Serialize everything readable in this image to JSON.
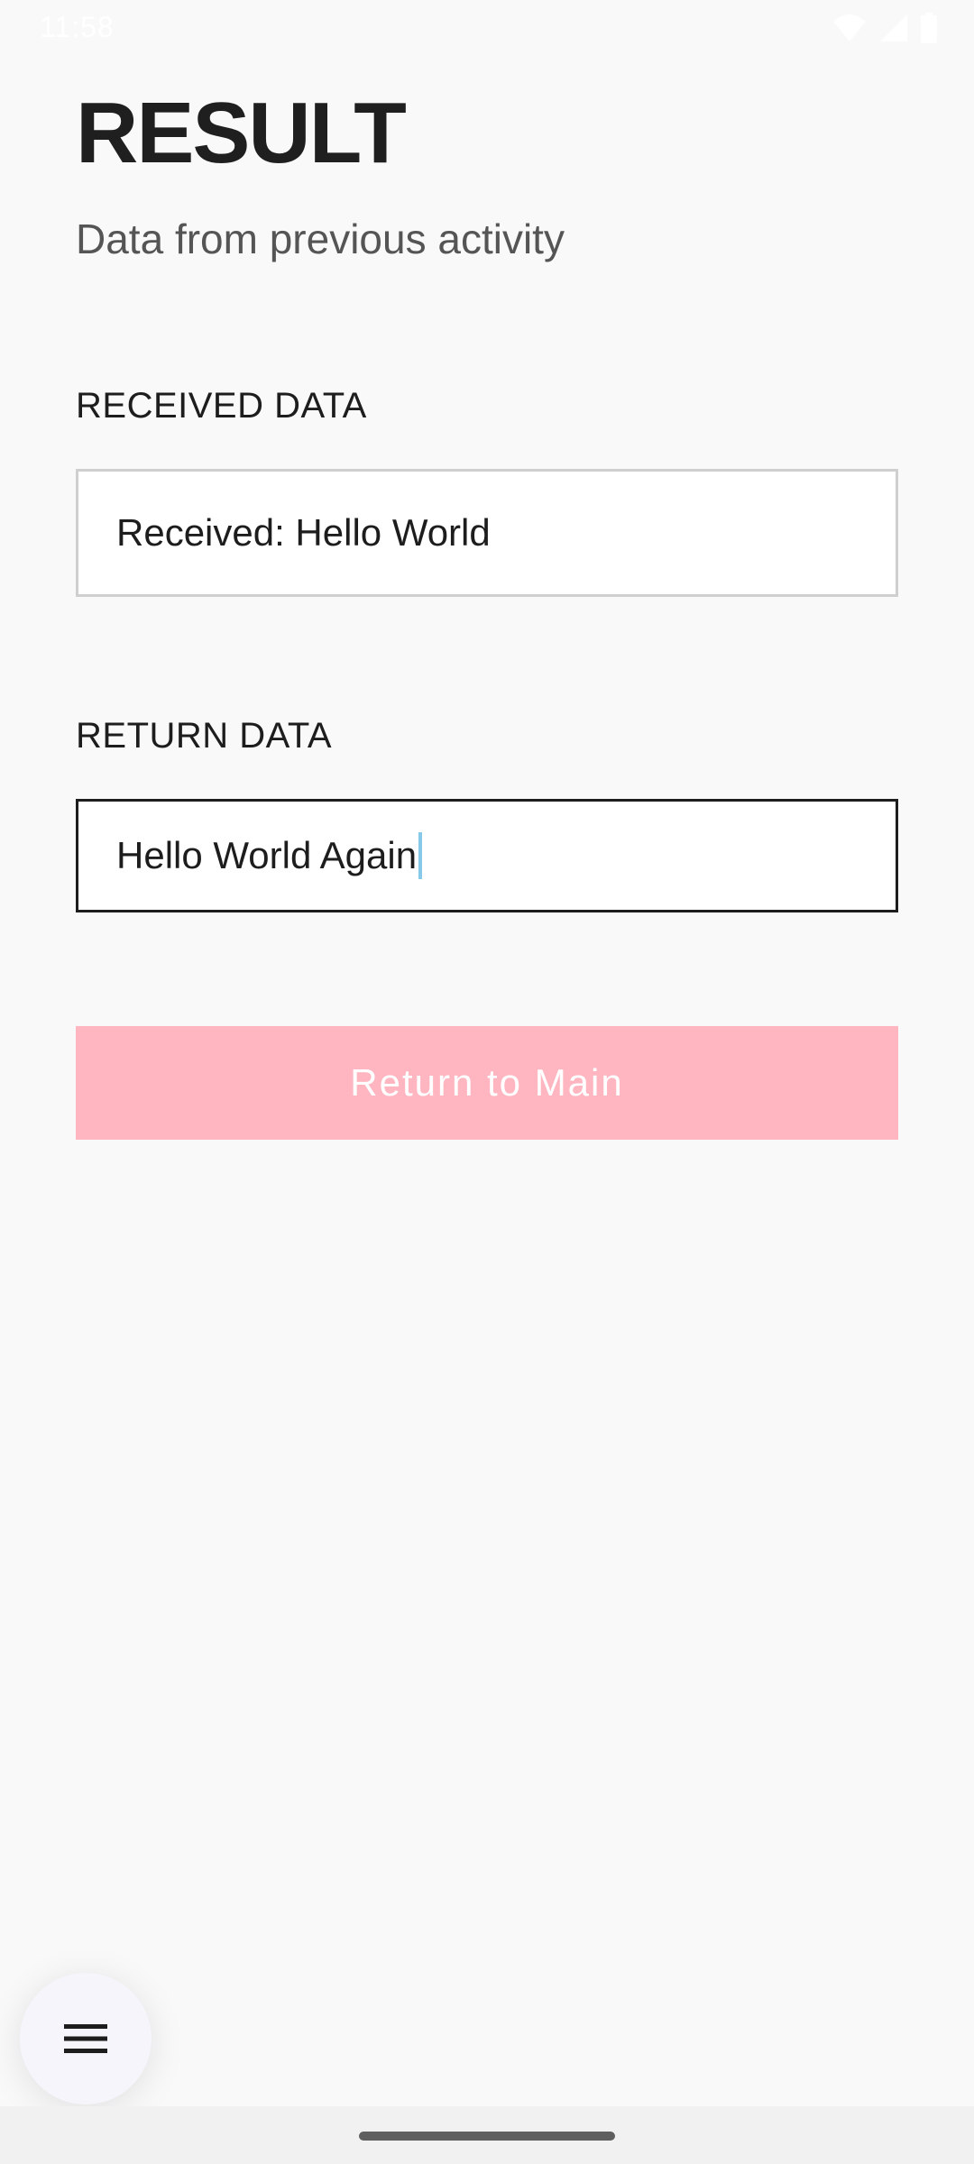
{
  "status_bar": {
    "time": "11:58",
    "icons": [
      "wifi-icon",
      "signal-icon",
      "battery-icon"
    ]
  },
  "header": {
    "title": "RESULT",
    "subtitle": "Data from previous activity"
  },
  "received": {
    "label": "RECEIVED DATA",
    "value": "Received: Hello World"
  },
  "return_data": {
    "label": "RETURN DATA",
    "value": "Hello World Again"
  },
  "actions": {
    "return_button_label": "Return to Main"
  },
  "colors": {
    "background": "#f9f9fa",
    "button_pink": "#ffb6c1",
    "caret": "#86c9e8"
  },
  "fab": {
    "icon": "menu-icon"
  }
}
